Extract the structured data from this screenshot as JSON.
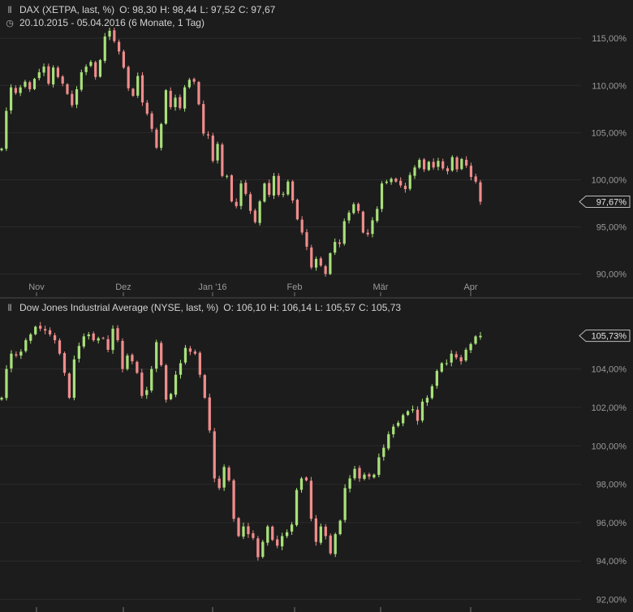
{
  "colors": {
    "background": "#1c1c1c",
    "up": "#a8e07a",
    "down": "#f08c8c",
    "grid": "#2a2a2a",
    "divider": "#4a4a4a"
  },
  "top_panel": {
    "title": "DAX (XETPA, last, %)",
    "open": "O: 98,30",
    "high": "H: 98,44",
    "low": "L: 97,52",
    "close": "C: 97,67",
    "range_text": "20.10.2015 - 05.04.2016 (6 Monate, 1 Tag)",
    "icon": "candlestick-icon",
    "range_icon": "clock-icon"
  },
  "bottom_panel": {
    "title": "Dow Jones Industrial Average (NYSE, last, %)",
    "open": "O: 106,10",
    "high": "H: 106,14",
    "low": "L: 105,57",
    "close": "C: 105,73",
    "icon": "candlestick-icon"
  },
  "x_labels": [
    "Nov",
    "Dez",
    "Jan '16",
    "Feb",
    "Mär",
    "Apr"
  ],
  "chart_data": [
    {
      "type": "candlestick",
      "title": "DAX (XETPA, last, %)",
      "y_ticks": [
        "90,00%",
        "95,00%",
        "100,00%",
        "105,00%",
        "110,00%",
        "115,00%"
      ],
      "ylim": [
        88.5,
        117
      ],
      "last_value_label": "97,67%",
      "last_value": 97.67,
      "closes": [
        103.3,
        107.3,
        109.8,
        109.2,
        109.8,
        110.4,
        109.6,
        110.7,
        111.4,
        112.0,
        110.2,
        111.9,
        110.9,
        110.2,
        109.1,
        107.9,
        109.6,
        111.4,
        112.0,
        112.5,
        110.9,
        112.7,
        115.2,
        115.8,
        114.7,
        113.6,
        111.9,
        109.7,
        108.9,
        111.0,
        108.2,
        107.0,
        105.4,
        103.4,
        105.9,
        109.5,
        107.7,
        108.7,
        107.6,
        109.8,
        110.6,
        110.4,
        108.0,
        104.9,
        104.7,
        102.0,
        103.8,
        100.4,
        100.4,
        97.7,
        97.2,
        99.6,
        98.5,
        96.7,
        95.5,
        97.7,
        99.6,
        98.4,
        100.4,
        98.4,
        98.5,
        99.8,
        97.8,
        95.8,
        94.4,
        92.9,
        90.7,
        91.6,
        90.9,
        90.0,
        92.2,
        93.4,
        93.2,
        95.6,
        96.5,
        97.4,
        96.7,
        94.4,
        94.2,
        95.7,
        96.9,
        99.6,
        99.8,
        100.1,
        99.8,
        99.4,
        99.0,
        100.5,
        101.3,
        102.1,
        101.1,
        101.9,
        101.3,
        102.0,
        101.2,
        100.9,
        102.4,
        101.1,
        102.2,
        101.5,
        100.3,
        99.8,
        97.67
      ]
    },
    {
      "type": "candlestick",
      "title": "Dow Jones Industrial Average (NYSE, last, %)",
      "y_ticks": [
        "92,00%",
        "94,00%",
        "96,00%",
        "98,00%",
        "100,00%",
        "102,00%",
        "104,00%"
      ],
      "ylim": [
        91.6,
        106.9
      ],
      "last_value_label": "105,73%",
      "last_value": 105.73,
      "closes": [
        102.5,
        104.0,
        104.8,
        104.7,
        104.9,
        105.5,
        105.8,
        106.2,
        106.1,
        106.0,
        105.8,
        105.5,
        104.8,
        103.8,
        102.5,
        104.5,
        105.2,
        105.7,
        105.8,
        105.5,
        105.6,
        105.6,
        105.0,
        106.1,
        105.5,
        104.0,
        104.7,
        104.4,
        103.8,
        102.6,
        102.9,
        104.0,
        105.4,
        104.2,
        102.4,
        102.7,
        103.7,
        104.3,
        105.1,
        104.9,
        104.8,
        103.7,
        102.5,
        100.8,
        98.3,
        97.8,
        98.9,
        98.2,
        96.2,
        95.3,
        95.8,
        95.4,
        95.2,
        94.2,
        95.0,
        95.8,
        95.1,
        94.8,
        95.3,
        95.5,
        95.9,
        97.7,
        98.3,
        98.2,
        96.2,
        95.0,
        95.8,
        95.3,
        94.4,
        95.4,
        96.1,
        97.8,
        98.3,
        98.8,
        98.3,
        98.5,
        98.4,
        98.5,
        99.4,
        99.9,
        100.6,
        101.0,
        101.2,
        101.6,
        101.8,
        101.9,
        101.3,
        102.3,
        102.5,
        103.1,
        103.9,
        104.3,
        104.3,
        104.8,
        104.6,
        104.4,
        105.0,
        105.3,
        105.7,
        105.73
      ]
    }
  ]
}
